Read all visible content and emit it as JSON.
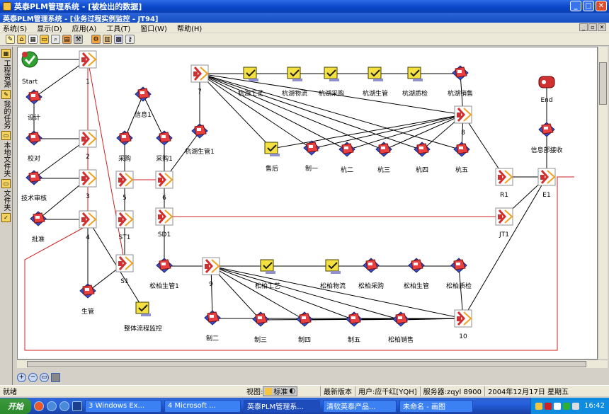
{
  "window": {
    "title": "英泰PLM管理系统 - [被检出的数据]"
  },
  "child": {
    "title": "英泰PLM管理系统 - [业务过程实例监控 - JT94]"
  },
  "menu": [
    "系统(S)",
    "显示(D)",
    "应用(A)",
    "工具(T)",
    "窗口(W)",
    "帮助(H)"
  ],
  "leftbar": [
    "工程资源",
    "我的任务",
    "本地文件夹",
    "文件夹"
  ],
  "status": {
    "ready": "就绪",
    "view": "视图:",
    "ime": "标准",
    "version": "最新版本",
    "user": "用户:应千红[YQH]",
    "server": "服务器:zqyl 8900",
    "date": "2004年12月17日 星期五"
  },
  "taskbar": {
    "start": "开始",
    "tasks": [
      "3 Windows Ex...",
      "4 Microsoft ...",
      "英泰PLM管理系...",
      "清软英泰产品...",
      "未命名 - 画图"
    ],
    "time": "16:42"
  },
  "diagram": {
    "start": "Start",
    "end": "End",
    "design": "设计",
    "check": "校对",
    "tech_review": "技术审核",
    "approve": "批准",
    "production": "生管",
    "monitor": "整体流程监控",
    "info1": "信息1",
    "purchase": "采购",
    "purchase1": "采购1",
    "hz_prod_mgr1": "杭湖生管1",
    "hz_process": "杭湖工艺",
    "hz_logistics": "杭湖物流",
    "hz_purchase": "杭湖采购",
    "hz_prod_mgr": "杭湖生管",
    "hz_qc": "杭湖质检",
    "hz_sales": "杭湖销售",
    "after_sales": "售后",
    "make1": "制一",
    "hang2": "杭二",
    "hang3": "杭三",
    "hang4": "杭四",
    "hang5": "杭五",
    "info_recv": "信息部接收",
    "sb_prod_mgr1": "松柏生管1",
    "sb_process": "松柏工艺",
    "sb_logistics": "松柏物流",
    "sb_purchase": "松柏采购",
    "sb_prod_mgr": "松柏生管",
    "sb_qc": "松柏质检",
    "make2": "制二",
    "make3": "制三",
    "make4": "制四",
    "make5": "制五",
    "sb_sales": "松柏销售",
    "n1": "1",
    "n2": "2",
    "n3": "3",
    "n4": "4",
    "n5": "5",
    "n6": "6",
    "n7": "7",
    "n8": "8",
    "n9": "9",
    "n10": "10",
    "st1": "ST1",
    "s1": "S1",
    "sd1": "SD1",
    "r1": "R1",
    "e1": "E1",
    "jt1": "JT1"
  }
}
